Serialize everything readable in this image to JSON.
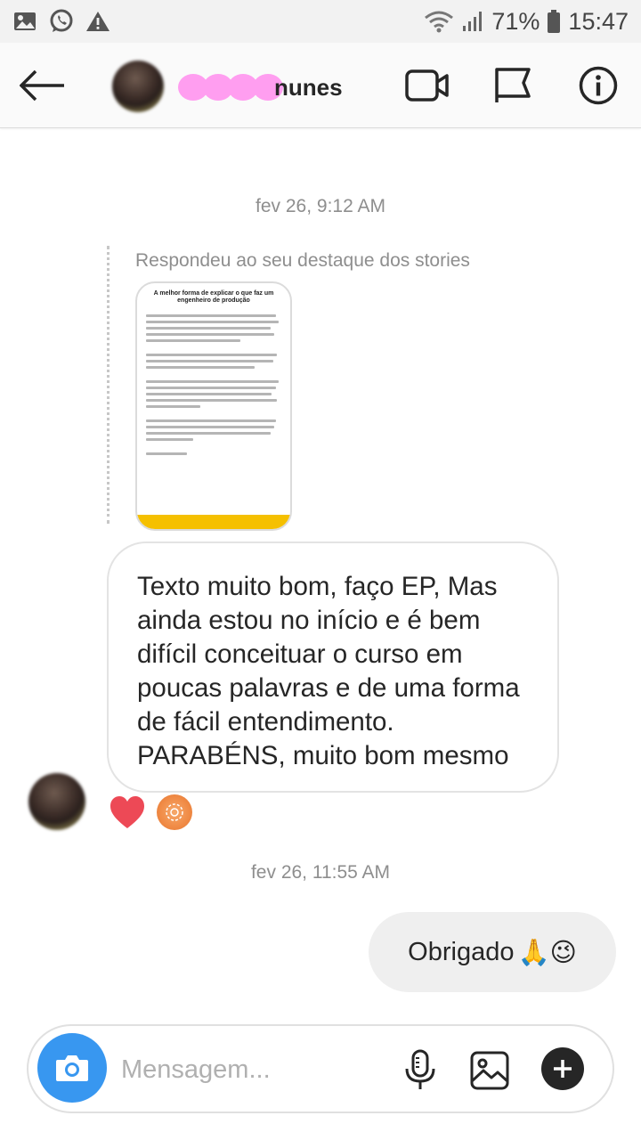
{
  "status_bar": {
    "battery": "71%",
    "time": "15:47"
  },
  "header": {
    "username": "nunes"
  },
  "conversation": {
    "timestamp_1": "fev 26, 9:12 AM",
    "reply_label": "Respondeu ao seu destaque dos stories",
    "story_preview_title": "A melhor forma de explicar o que faz um engenheiro de produção",
    "incoming_message": "Texto muito bom, faço EP, Mas ainda estou no início e é bem difícil conceituar o curso em poucas palavras e de uma forma de fácil entendimento. PARABÉNS, muito bom mesmo",
    "timestamp_2": "fev 26, 11:55 AM",
    "outgoing_message": "Obrigado",
    "outgoing_emojis": "🙏😉"
  },
  "composer": {
    "placeholder": "Mensagem..."
  },
  "colors": {
    "accent": "#3897f0",
    "heart": "#ed4956",
    "redaction": "#ff9ef0",
    "story_bar": "#f5c000"
  }
}
